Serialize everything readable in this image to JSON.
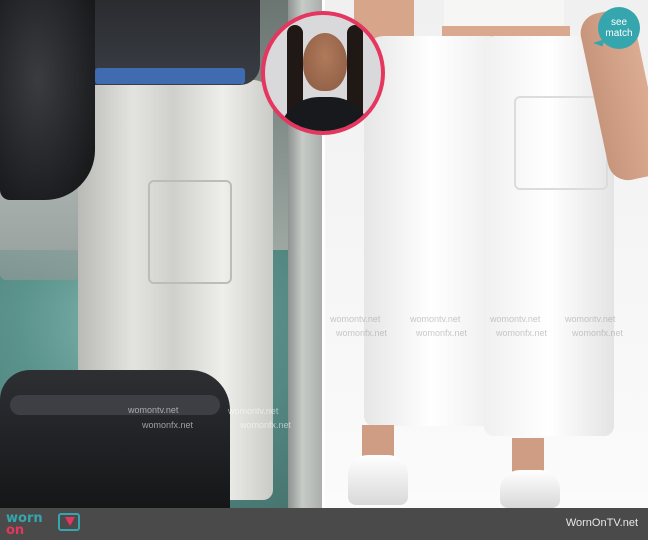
{
  "badge": {
    "line1": "see",
    "line2": "match"
  },
  "watermarks": {
    "text1": "womontv.net",
    "text2": "womonfx.net"
  },
  "footer": {
    "logo_top": "worn",
    "logo_bottom": "on",
    "credit": "WornOnTV.net"
  },
  "colors": {
    "brand_teal": "#35a6ad",
    "brand_pink": "#e5365f",
    "footer_bg": "#4a4a4a"
  }
}
